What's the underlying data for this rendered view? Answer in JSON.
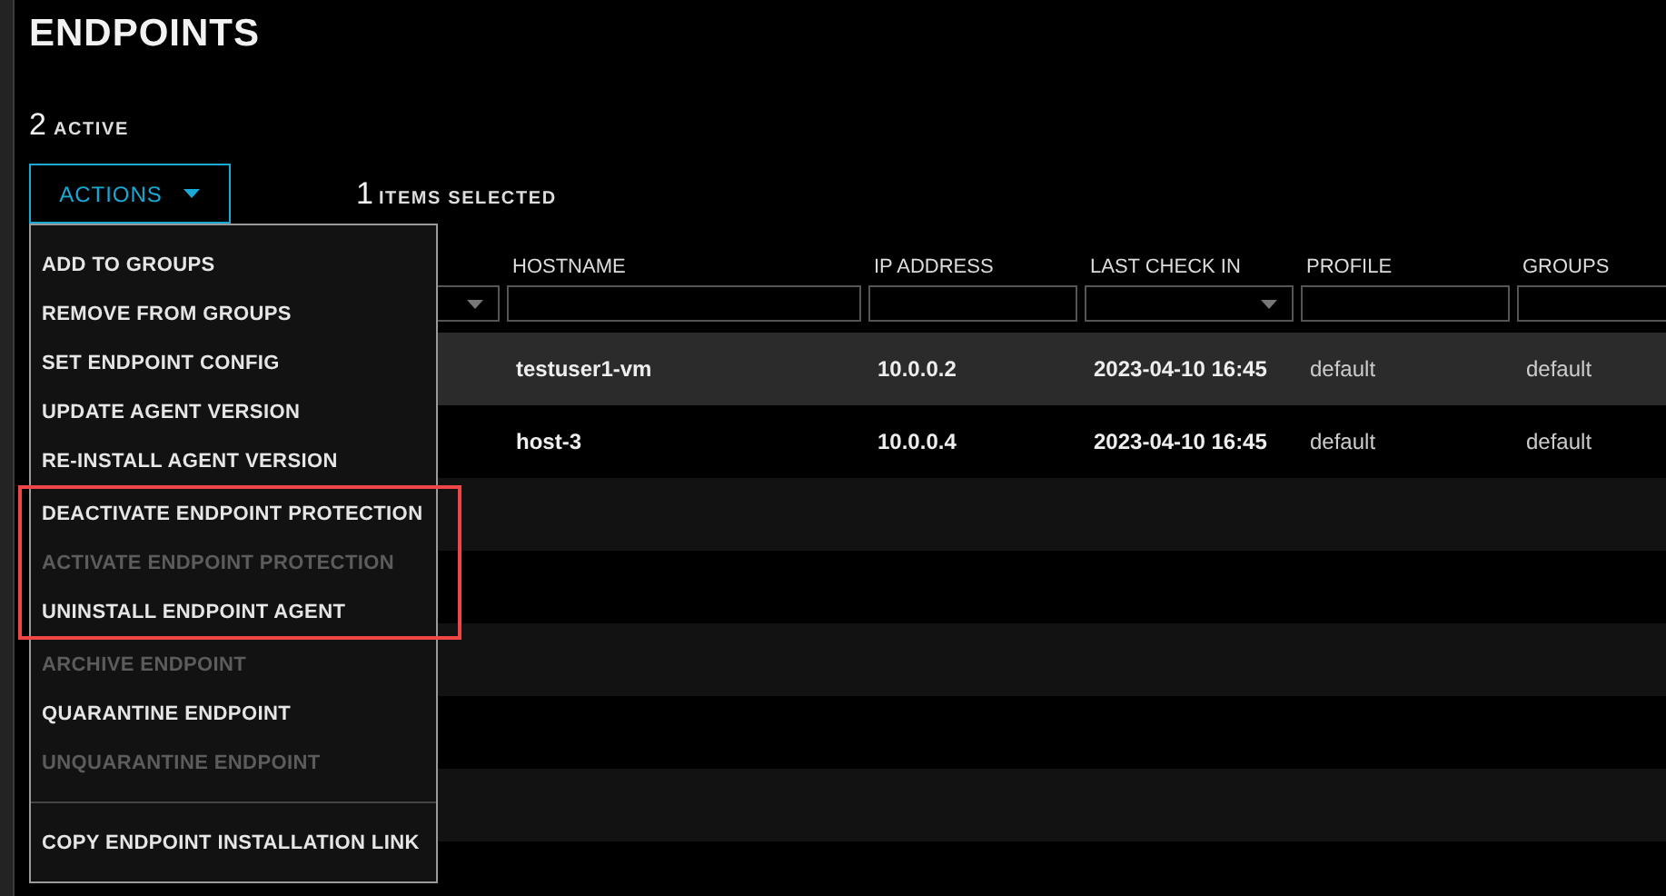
{
  "page": {
    "title": "ENDPOINTS",
    "active_count": "2",
    "active_label": "ACTIVE"
  },
  "actions_button": {
    "label": "ACTIONS",
    "expanded": true
  },
  "selection": {
    "count": "1",
    "label": "ITEMS SELECTED"
  },
  "actions_menu": [
    {
      "label": "ADD TO GROUPS",
      "disabled": false,
      "highlighted": false
    },
    {
      "label": "REMOVE FROM GROUPS",
      "disabled": false,
      "highlighted": false
    },
    {
      "label": "SET ENDPOINT CONFIG",
      "disabled": false,
      "highlighted": false
    },
    {
      "label": "UPDATE AGENT VERSION",
      "disabled": false,
      "highlighted": false
    },
    {
      "label": "RE-INSTALL AGENT VERSION",
      "disabled": false,
      "highlighted": false
    },
    {
      "label": "DEACTIVATE ENDPOINT PROTECTION",
      "disabled": false,
      "highlighted": true
    },
    {
      "label": "ACTIVATE ENDPOINT PROTECTION",
      "disabled": true,
      "highlighted": true
    },
    {
      "label": "UNINSTALL ENDPOINT AGENT",
      "disabled": false,
      "highlighted": true
    },
    {
      "label": "ARCHIVE ENDPOINT",
      "disabled": true,
      "highlighted": false
    },
    {
      "label": "QUARANTINE ENDPOINT",
      "disabled": false,
      "highlighted": false
    },
    {
      "label": "UNQUARANTINE ENDPOINT",
      "disabled": true,
      "highlighted": false
    },
    {
      "kind": "divider"
    },
    {
      "label": "COPY ENDPOINT INSTALLATION LINK",
      "disabled": false,
      "highlighted": false
    }
  ],
  "table": {
    "columns": [
      {
        "kind": "select"
      },
      {
        "label": "HOSTNAME",
        "kind": "text"
      },
      {
        "label": "IP ADDRESS",
        "kind": "text"
      },
      {
        "label": "LAST CHECK IN",
        "kind": "select"
      },
      {
        "label": "PROFILE",
        "kind": "text"
      },
      {
        "label": "GROUPS",
        "kind": "text"
      }
    ],
    "rows": [
      {
        "selected": true,
        "hostname": "testuser1-vm",
        "ip_address": "10.0.0.2",
        "last_check_in": "2023-04-10 16:45",
        "profile": "default",
        "groups": "default"
      },
      {
        "selected": false,
        "hostname": "host-3",
        "ip_address": "10.0.0.4",
        "last_check_in": "2023-04-10 16:45",
        "profile": "default",
        "groups": "default"
      }
    ]
  }
}
